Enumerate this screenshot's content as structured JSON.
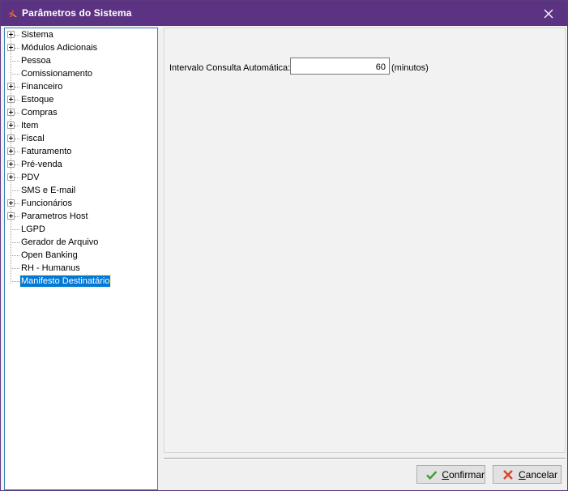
{
  "window": {
    "title": "Parâmetros do Sistema"
  },
  "tree": {
    "items": [
      {
        "label": "Sistema",
        "expandable": true
      },
      {
        "label": "Módulos Adicionais",
        "expandable": true
      },
      {
        "label": "Pessoa",
        "expandable": false
      },
      {
        "label": "Comissionamento",
        "expandable": false
      },
      {
        "label": "Financeiro",
        "expandable": true
      },
      {
        "label": "Estoque",
        "expandable": true
      },
      {
        "label": "Compras",
        "expandable": true
      },
      {
        "label": "Item",
        "expandable": true
      },
      {
        "label": "Fiscal",
        "expandable": true
      },
      {
        "label": "Faturamento",
        "expandable": true
      },
      {
        "label": "Pré-venda",
        "expandable": true
      },
      {
        "label": "PDV",
        "expandable": true
      },
      {
        "label": "SMS e E-mail",
        "expandable": false
      },
      {
        "label": "Funcionários",
        "expandable": true
      },
      {
        "label": "Parametros Host",
        "expandable": true
      },
      {
        "label": "LGPD",
        "expandable": false
      },
      {
        "label": "Gerador de Arquivo",
        "expandable": false
      },
      {
        "label": "Open Banking",
        "expandable": false
      },
      {
        "label": "RH - Humanus",
        "expandable": false
      },
      {
        "label": "Manifesto Destinatário",
        "expandable": false,
        "selected": true
      }
    ]
  },
  "panel": {
    "field_label": "Intervalo Consulta Automática:",
    "field_value": "60",
    "field_unit": "(minutos)"
  },
  "buttons": {
    "confirm_first": "C",
    "confirm_rest": "onfirmar",
    "cancel_first": "C",
    "cancel_rest": "ancelar"
  },
  "colors": {
    "titlebar": "#5c3382",
    "selection": "#0078d7",
    "confirm_icon": "#3a9a3a",
    "cancel_icon": "#d9432b"
  }
}
